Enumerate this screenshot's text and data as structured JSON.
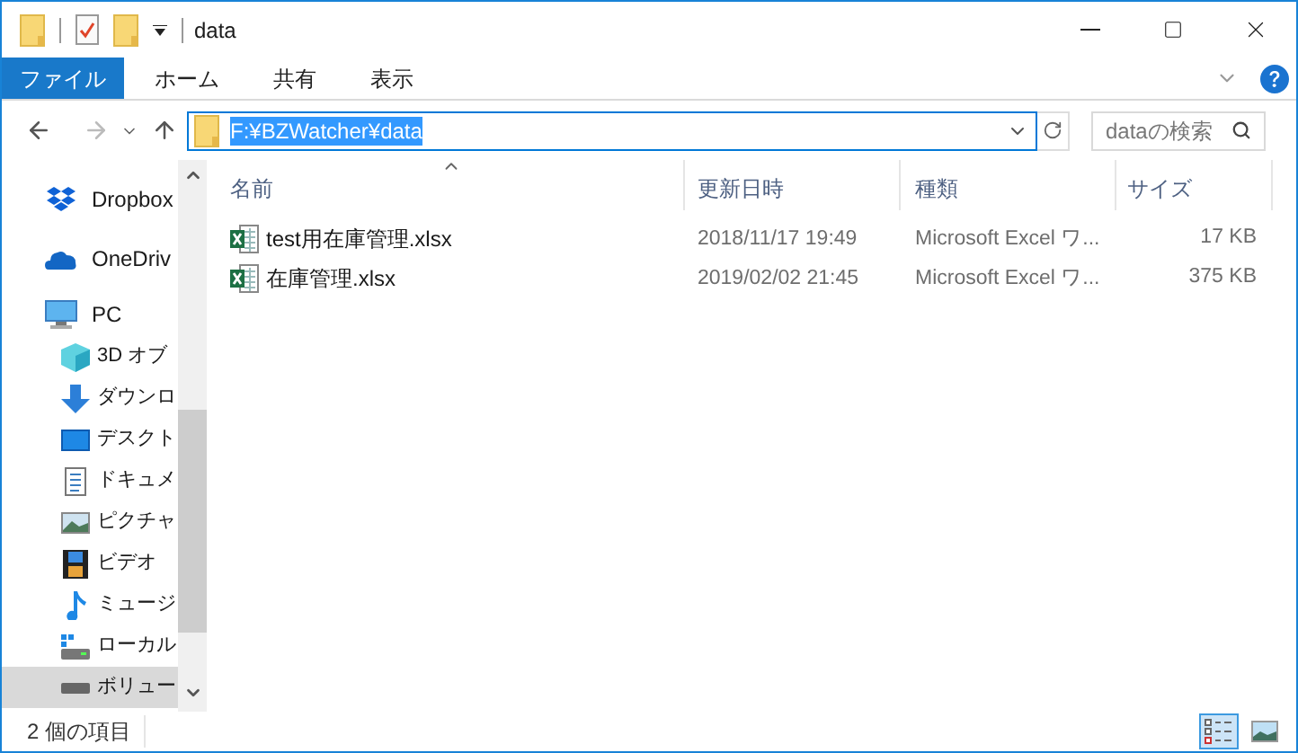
{
  "window": {
    "title": "data"
  },
  "ribbon_tabs": [
    {
      "label": "ファイル",
      "selected": true
    },
    {
      "label": "ホーム",
      "selected": false
    },
    {
      "label": "共有",
      "selected": false
    },
    {
      "label": "表示",
      "selected": false
    }
  ],
  "address_bar": {
    "value": "F:¥BZWatcher¥data",
    "selected": true
  },
  "search": {
    "placeholder": "dataの検索"
  },
  "sidebar": {
    "items": [
      {
        "label": "Dropbox",
        "selected": false
      },
      {
        "label": "OneDriv",
        "selected": false
      },
      {
        "label": "PC",
        "selected": false,
        "children": [
          {
            "label": "3D オブ",
            "selected": false
          },
          {
            "label": "ダウンロ",
            "selected": false
          },
          {
            "label": "デスクト",
            "selected": false
          },
          {
            "label": "ドキュメ",
            "selected": false
          },
          {
            "label": "ピクチャ",
            "selected": false
          },
          {
            "label": "ビデオ",
            "selected": false
          },
          {
            "label": "ミュージ",
            "selected": false
          },
          {
            "label": "ローカル",
            "selected": false
          },
          {
            "label": "ボリュー",
            "selected": true
          }
        ]
      }
    ]
  },
  "table": {
    "columns": [
      {
        "label": "名前",
        "sorted": true
      },
      {
        "label": "更新日時",
        "sorted": false
      },
      {
        "label": "種類",
        "sorted": false
      },
      {
        "label": "サイズ",
        "sorted": false
      }
    ],
    "rows": [
      {
        "name": "test用在庫管理.xlsx",
        "modified": "2018/11/17 19:49",
        "type": "Microsoft Excel ワ...",
        "size": "17 KB"
      },
      {
        "name": "在庫管理.xlsx",
        "modified": "2019/02/02 21:45",
        "type": "Microsoft Excel ワ...",
        "size": "375 KB"
      }
    ]
  },
  "status_bar": {
    "text": "2 個の項目",
    "views": [
      {
        "kind": "details",
        "selected": true
      },
      {
        "kind": "thumbnails",
        "selected": false
      }
    ]
  }
}
